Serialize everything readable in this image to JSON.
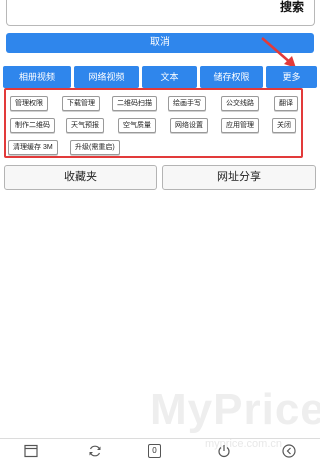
{
  "search": {
    "button_label": "搜索"
  },
  "cancel_label": "取消",
  "tabs": [
    {
      "label": "相册视频"
    },
    {
      "label": "网络视频"
    },
    {
      "label": "文本"
    },
    {
      "label": "储存权限"
    },
    {
      "label": "更多"
    }
  ],
  "functions": [
    {
      "label": "管理权限"
    },
    {
      "label": "下载管理"
    },
    {
      "label": "二维码扫描"
    },
    {
      "label": "绘画手写"
    },
    {
      "label": "公交线路"
    },
    {
      "label": "翻译"
    },
    {
      "label": "制作二维码"
    },
    {
      "label": "天气预报"
    },
    {
      "label": "空气质量"
    },
    {
      "label": "网络设置"
    },
    {
      "label": "应用管理"
    },
    {
      "label": "关闭"
    },
    {
      "label": "清理缓存 3M"
    },
    {
      "label": "升级(需重启)"
    }
  ],
  "favorites_label": "收藏夹",
  "share_label": "网址分享",
  "nav": {
    "tab_count": "0"
  },
  "watermark": {
    "brand": "MyPrice",
    "url": "myprice.com.cn"
  },
  "colors": {
    "accent": "#2f86ec",
    "highlight": "#e23a3a"
  }
}
